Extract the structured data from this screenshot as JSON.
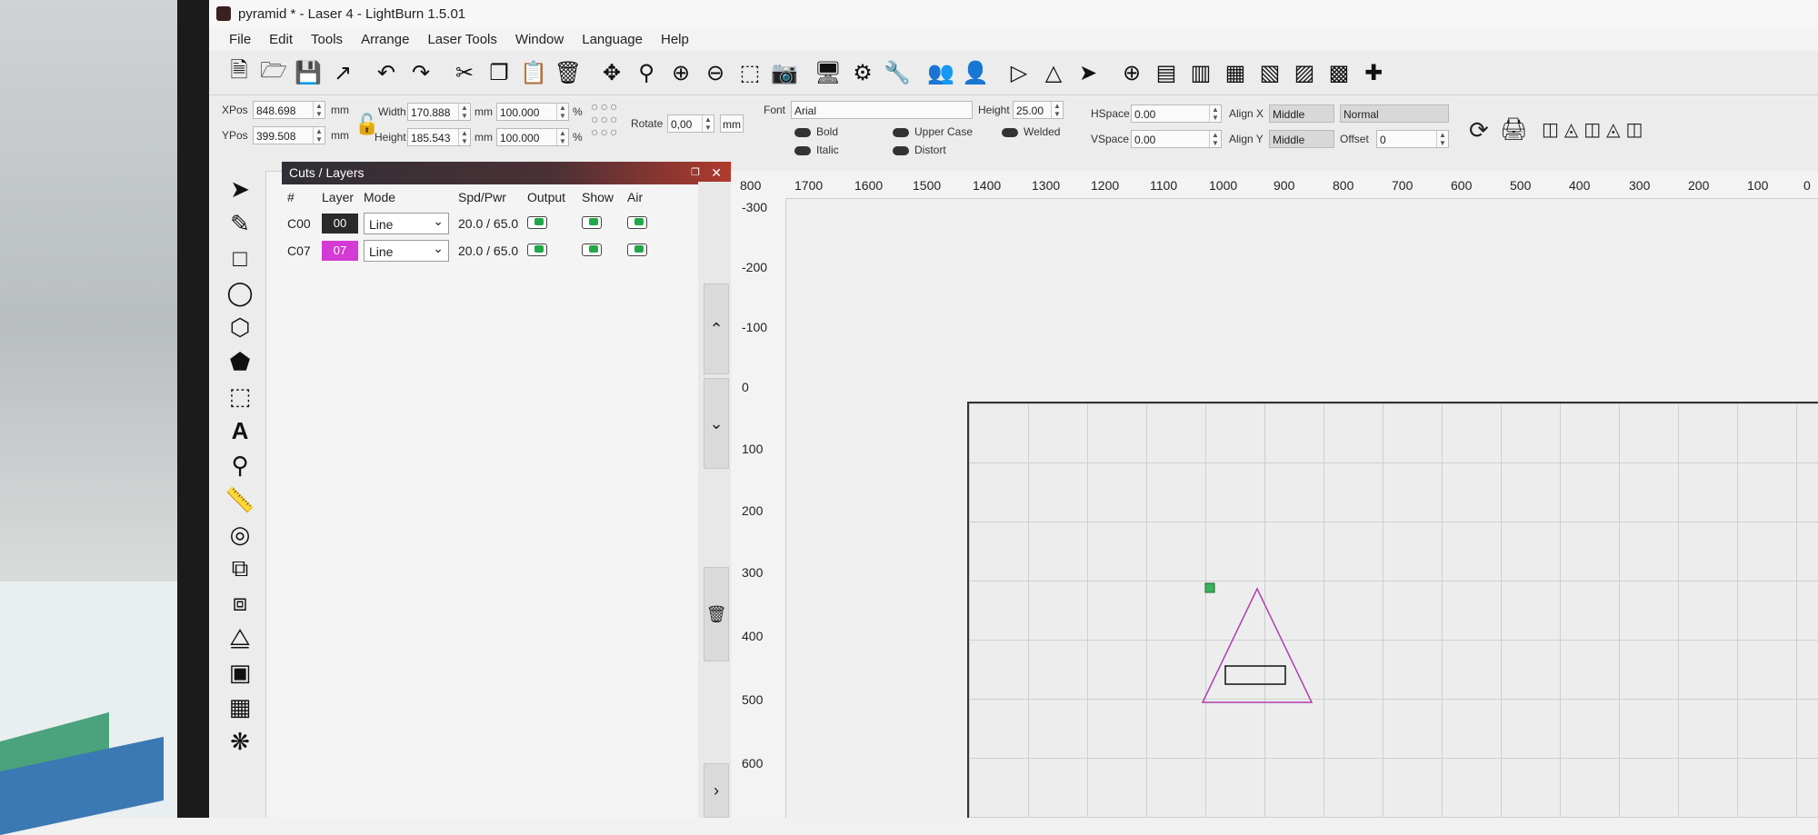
{
  "window": {
    "title": "pyramid * - Laser 4 - LightBurn 1.5.01"
  },
  "menu": [
    "File",
    "Edit",
    "Tools",
    "Arrange",
    "Laser Tools",
    "Window",
    "Language",
    "Help"
  ],
  "toolbar_icons": [
    "new-file-icon",
    "open-folder-icon",
    "save-icon",
    "export-icon",
    "undo-icon",
    "redo-icon",
    "cut-icon",
    "copy-icon",
    "paste-icon",
    "delete-icon",
    "move-icon",
    "zoom-fit-icon",
    "zoom-in-icon",
    "zoom-out-icon",
    "select-frame-icon",
    "camera-icon",
    "monitor-icon",
    "settings-icon",
    "tools-icon",
    "group-icon",
    "user-icon",
    "mirror-h-icon",
    "mirror-v-icon",
    "send-icon",
    "target-icon",
    "align-left-icon",
    "align-center-icon",
    "distribute-icon",
    "distribute-v-icon",
    "align-top-icon",
    "align-middle-icon",
    "crosshair-icon"
  ],
  "props": {
    "xpos_label": "XPos",
    "xpos": "848.698",
    "ypos_label": "YPos",
    "ypos": "399.508",
    "mm": "mm",
    "width_label": "Width",
    "width": "170.888",
    "height_label": "Height",
    "height": "185.543",
    "wpct": "100.000",
    "hpct": "100.000",
    "pct": "%",
    "rotate_label": "Rotate",
    "rotate": "0,00",
    "mm_btn": "mm",
    "font_label": "Font",
    "font": "Arial",
    "text_height_label": "Height",
    "text_height": "25.00",
    "bold": "Bold",
    "italic": "Italic",
    "upper": "Upper Case",
    "distort": "Distort",
    "welded": "Welded",
    "hspace_label": "HSpace",
    "hspace": "0.00",
    "vspace_label": "VSpace",
    "vspace": "0.00",
    "alignx_label": "Align X",
    "alignx": "Middle",
    "aligny_label": "Align Y",
    "aligny": "Middle",
    "normal": "Normal",
    "offset_label": "Offset",
    "offset": "0"
  },
  "cuts": {
    "title": "Cuts / Layers",
    "headers": {
      "num": "#",
      "layer": "Layer",
      "mode": "Mode",
      "spd": "Spd/Pwr",
      "output": "Output",
      "show": "Show",
      "air": "Air"
    },
    "rows": [
      {
        "num": "C00",
        "layer": "00",
        "color": "#2a2a2a",
        "mode": "Line",
        "spd": "20.0 / 65.0"
      },
      {
        "num": "C07",
        "layer": "07",
        "color": "#d43ad4",
        "mode": "Line",
        "spd": "20.0 / 65.0"
      }
    ]
  },
  "ruler_x": [
    "800",
    "1700",
    "1600",
    "1500",
    "1400",
    "1300",
    "1200",
    "1100",
    "1000",
    "900",
    "800",
    "700",
    "600",
    "500",
    "400",
    "300",
    "200",
    "100",
    "0"
  ],
  "ruler_y": [
    "-300",
    "-200",
    "-100",
    "0",
    "100",
    "200",
    "300",
    "400",
    "500",
    "600"
  ],
  "canvas_mark": "x"
}
